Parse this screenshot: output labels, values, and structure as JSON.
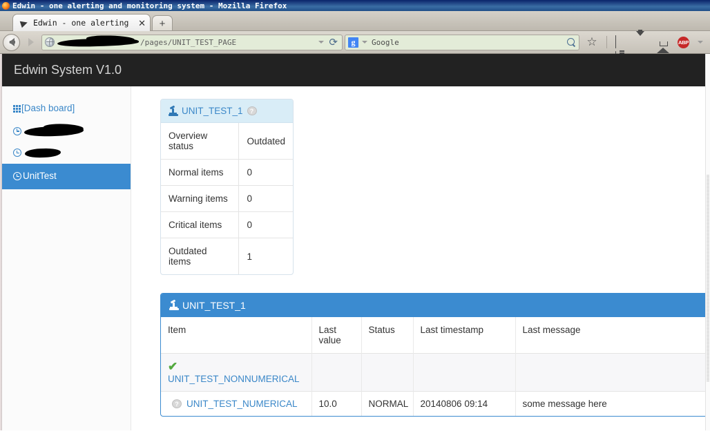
{
  "browser": {
    "window_title": "Edwin - one alerting and monitoring system - Mozilla Firefox",
    "tab_title": "Edwin - one alerting an⋯",
    "tab_close_label": "✕",
    "new_tab_label": "+",
    "url_text": "/pages/UNIT_TEST_PAGE",
    "url_redacted": true,
    "reload_label": "⟳",
    "search_engine": "Google",
    "search_engine_initial": "g",
    "abp_label": "ABP",
    "icons": {
      "back": "back-arrow-icon",
      "forward": "forward-arrow-icon",
      "identity": "globe-icon",
      "search": "search-magnifier-icon",
      "bookmark": "star-icon",
      "reading_list": "reading-list-icon",
      "downloads": "download-arrow-icon",
      "home": "home-icon",
      "adblock": "adblock-plus-icon"
    }
  },
  "app": {
    "brand": "Edwin System V1.0"
  },
  "sidebar": {
    "items": [
      {
        "label": "[Dash board]",
        "icon": "grid-icon",
        "active": false,
        "redacted": false
      },
      {
        "label": "",
        "icon": "clock-icon",
        "active": false,
        "redacted": true
      },
      {
        "label": "",
        "icon": "clock-icon",
        "active": false,
        "redacted": true
      },
      {
        "label": "UnitTest",
        "icon": "clock-icon",
        "active": true,
        "redacted": false
      }
    ]
  },
  "overview": {
    "title": "UNIT_TEST_1",
    "title_icon": "microscope-icon",
    "status_badge": "?",
    "rows": [
      {
        "key": "Overview status",
        "value": "Outdated"
      },
      {
        "key": "Normal items",
        "value": "0"
      },
      {
        "key": "Warning items",
        "value": "0"
      },
      {
        "key": "Critical items",
        "value": "0"
      },
      {
        "key": "Outdated items",
        "value": "1"
      }
    ]
  },
  "items_panel": {
    "title": "UNIT_TEST_1",
    "title_icon": "microscope-icon",
    "columns": [
      "Item",
      "Last value",
      "Status",
      "Last timestamp",
      "Last message"
    ],
    "rows": [
      {
        "icon": "green-check-icon",
        "item": "UNIT_TEST_NONNUMERICAL",
        "last_value": "",
        "status": "",
        "last_timestamp": "",
        "last_message": ""
      },
      {
        "icon": "question-badge-icon",
        "item": "UNIT_TEST_NUMERICAL",
        "last_value": "10.0",
        "status": "NORMAL",
        "last_timestamp": "20140806 09:14",
        "last_message": "some message here"
      }
    ]
  },
  "colors": {
    "accent_blue": "#3b8bd0",
    "link_blue": "#3a87c8",
    "panel_head_light": "#d9edf7",
    "navbar_dark": "#222222",
    "status_normal_green": "#2a6b2a",
    "timestamp_olive": "#97844a",
    "check_green": "#53a93f"
  }
}
